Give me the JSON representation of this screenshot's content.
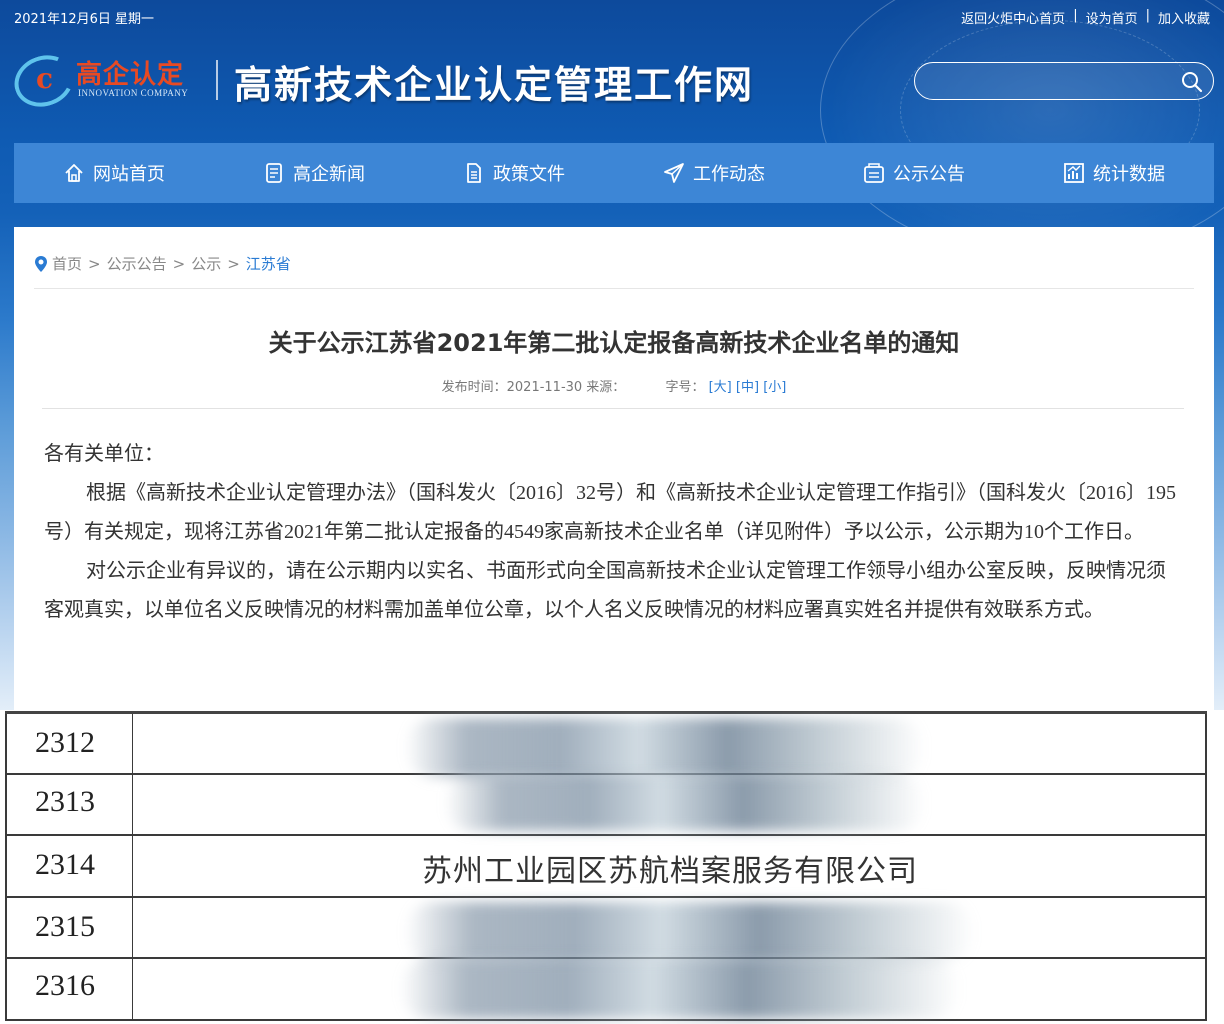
{
  "topbar": {
    "date": "2021年12月6日 星期一",
    "links": [
      "返回火炬中心首页",
      "设为首页",
      "加入收藏"
    ]
  },
  "logo": {
    "cn": "高企认定",
    "en": "INNOVATION COMPANY"
  },
  "site_title": "高新技术企业认定管理工作网",
  "search": {
    "placeholder": ""
  },
  "nav": [
    {
      "label": "网站首页",
      "icon": "home-icon"
    },
    {
      "label": "高企新闻",
      "icon": "news-icon"
    },
    {
      "label": "政策文件",
      "icon": "document-icon"
    },
    {
      "label": "工作动态",
      "icon": "send-icon"
    },
    {
      "label": "公示公告",
      "icon": "inbox-icon"
    },
    {
      "label": "统计数据",
      "icon": "chart-icon"
    }
  ],
  "breadcrumb": [
    "首页",
    "公示公告",
    "公示",
    "江苏省"
  ],
  "article": {
    "title": "关于公示江苏省2021年第二批认定报备高新技术企业名单的通知",
    "publish_label": "发布时间：2021-11-30 来源：",
    "fontsize_label": "字号：",
    "size_large": "[大]",
    "size_medium": "[中]",
    "size_small": "[小]",
    "salutation": "各有关单位：",
    "para1": "根据《高新技术企业认定管理办法》（国科发火〔2016〕32号）和《高新技术企业认定管理工作指引》（国科发火〔2016〕195号）有关规定，现将江苏省2021年第二批认定报备的4549家高新技术企业名单（详见附件）予以公示，公示期为10个工作日。",
    "para2": "对公示企业有异议的，请在公示期内以实名、书面形式向全国高新技术企业认定管理工作领导小组办公室反映，反映情况须客观真实，以单位名义反映情况的材料需加盖单位公章，以个人名义反映情况的材料应署真实姓名并提供有效联系方式。"
  },
  "table_rows": [
    {
      "num": "2312",
      "name": ""
    },
    {
      "num": "2313",
      "name": ""
    },
    {
      "num": "2314",
      "name": "苏州工业园区苏航档案服务有限公司"
    },
    {
      "num": "2315",
      "name": ""
    },
    {
      "num": "2316",
      "name": ""
    }
  ],
  "colors": {
    "nav_bg": "#3d86d6",
    "header_dark": "#0d4a9c",
    "link_blue": "#2a7bd3",
    "logo_red": "#e84a23"
  }
}
